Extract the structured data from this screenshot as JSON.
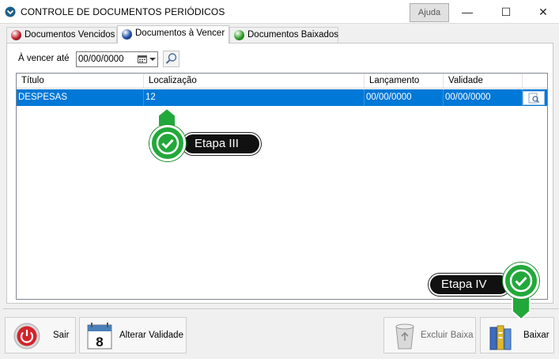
{
  "window": {
    "title": "CONTROLE DE DOCUMENTOS PERIÓDICOS",
    "help_label": "Ajuda",
    "minimize_glyph": "—",
    "maximize_glyph": "☐",
    "close_glyph": "✕"
  },
  "tabs": [
    {
      "label": "Documentos Vencidos",
      "color": "#c0202a",
      "active": false
    },
    {
      "label": "Documentos à Vencer",
      "color": "#1f4fa8",
      "active": true
    },
    {
      "label": "Documentos Baixados",
      "color": "#2fa02a",
      "active": false
    }
  ],
  "filter": {
    "label": "À vencer até",
    "date_value": "00/00/0000",
    "icons": [
      "calendar-icon",
      "search-icon"
    ]
  },
  "table": {
    "columns": [
      "Título",
      "Localização",
      "Lançamento",
      "Validade"
    ],
    "rows": [
      {
        "titulo": "DESPESAS",
        "localizacao": "12",
        "lancamento": "00/00/0000",
        "validade": "00/00/0000"
      }
    ]
  },
  "buttons": {
    "sair": "Sair",
    "alterar_validade": "Alterar Validade",
    "calendar_day": "8",
    "excluir_baixa": "Excluir Baixa",
    "baixar": "Baixar"
  },
  "callouts": {
    "step3": "Etapa III",
    "step4": "Etapa IV"
  },
  "colors": {
    "selection": "#0078d7",
    "callout_green": "#22a83a",
    "callout_dark": "#111111"
  }
}
